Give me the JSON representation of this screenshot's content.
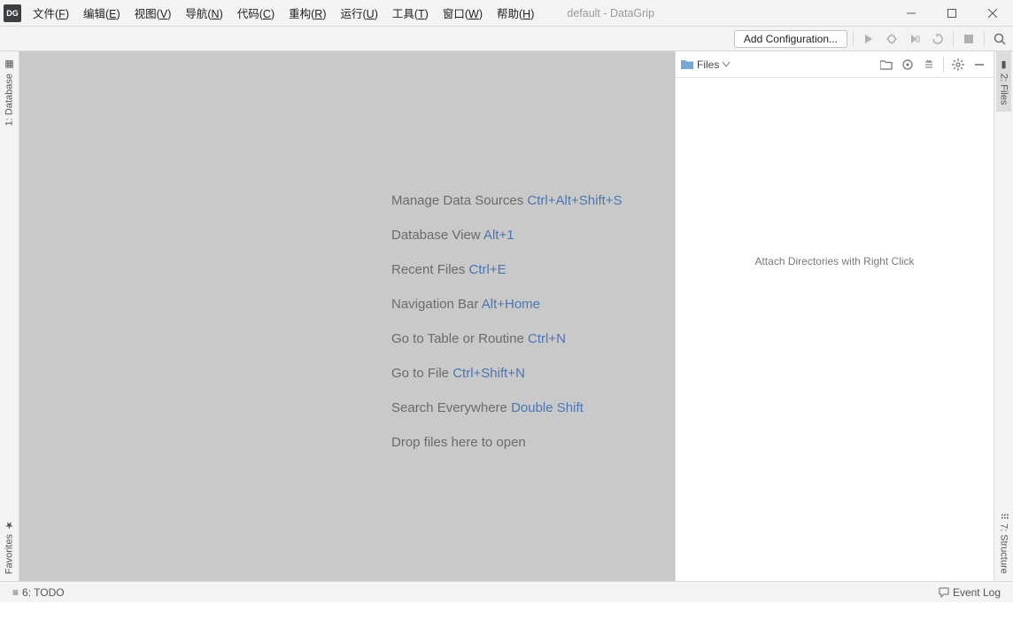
{
  "titlebar": {
    "title": "default - DataGrip",
    "app_short": "DG"
  },
  "menu": [
    {
      "label": "文件",
      "key": "F"
    },
    {
      "label": "编辑",
      "key": "E"
    },
    {
      "label": "视图",
      "key": "V"
    },
    {
      "label": "导航",
      "key": "N"
    },
    {
      "label": "代码",
      "key": "C"
    },
    {
      "label": "重构",
      "key": "R"
    },
    {
      "label": "运行",
      "key": "U"
    },
    {
      "label": "工具",
      "key": "T"
    },
    {
      "label": "窗口",
      "key": "W"
    },
    {
      "label": "帮助",
      "key": "H"
    }
  ],
  "toolbar": {
    "add_config": "Add Configuration..."
  },
  "left_tabs": {
    "database": "1: Database",
    "favorites": "Favorites"
  },
  "right_tabs": {
    "files": "2: Files",
    "structure": "7: Structure"
  },
  "files_panel": {
    "title": "Files",
    "empty_text": "Attach Directories with Right Click"
  },
  "hints": [
    {
      "label": "Manage Data Sources",
      "shortcut": "Ctrl+Alt+Shift+S"
    },
    {
      "label": "Database View",
      "shortcut": "Alt+1"
    },
    {
      "label": "Recent Files",
      "shortcut": "Ctrl+E"
    },
    {
      "label": "Navigation Bar",
      "shortcut": "Alt+Home"
    },
    {
      "label": "Go to Table or Routine",
      "shortcut": "Ctrl+N"
    },
    {
      "label": "Go to File",
      "shortcut": "Ctrl+Shift+N"
    },
    {
      "label": "Search Everywhere",
      "shortcut": "Double Shift"
    },
    {
      "label": "Drop files here to open",
      "shortcut": ""
    }
  ],
  "statusbar": {
    "todo": "6: TODO",
    "event_log": "Event Log"
  }
}
